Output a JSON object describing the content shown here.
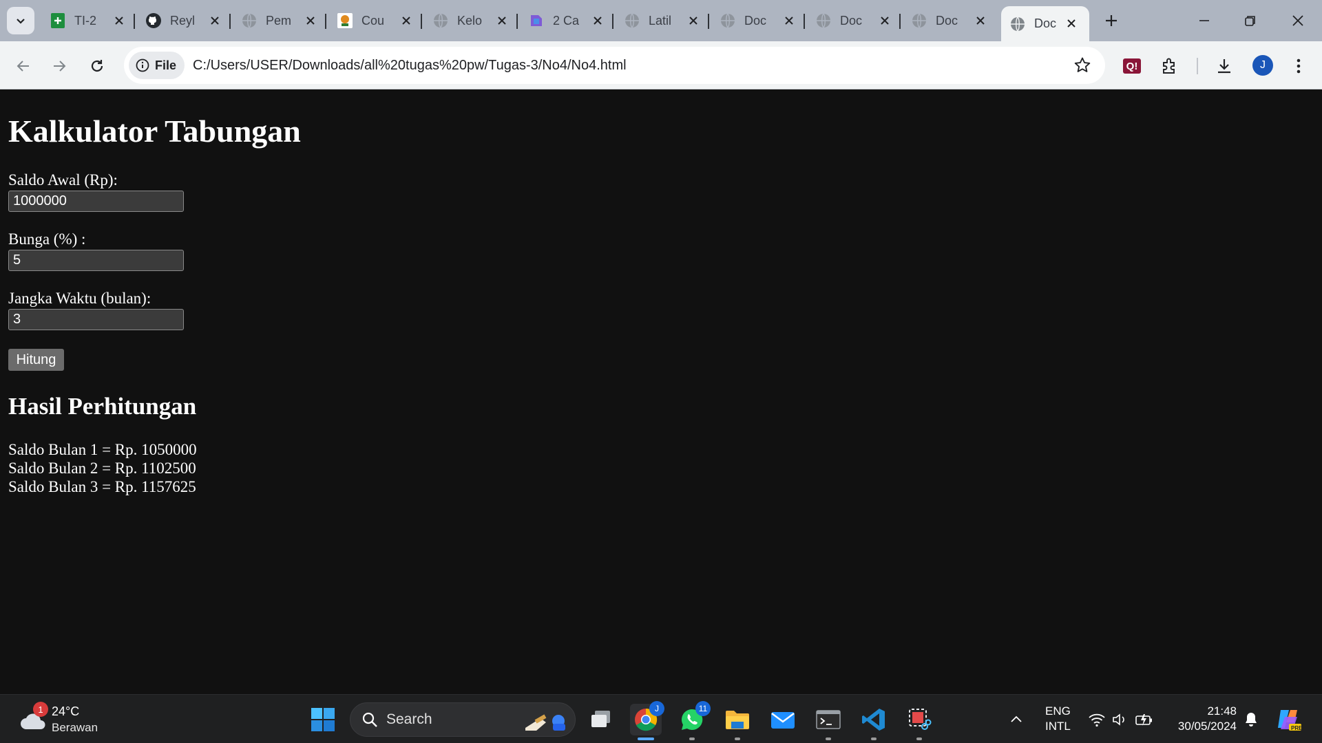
{
  "browser": {
    "tabs": [
      {
        "label": "TI-2",
        "icon": "sheets-icon"
      },
      {
        "label": "Reyl",
        "icon": "github-icon"
      },
      {
        "label": "Pem",
        "icon": "globe-icon"
      },
      {
        "label": "Cou",
        "icon": "site-icon"
      },
      {
        "label": "Kelo",
        "icon": "globe-icon"
      },
      {
        "label": "2 Ca",
        "icon": "app-icon"
      },
      {
        "label": "Latil",
        "icon": "globe-icon"
      },
      {
        "label": "Doc",
        "icon": "globe-icon"
      },
      {
        "label": "Doc",
        "icon": "globe-icon"
      },
      {
        "label": "Doc",
        "icon": "globe-icon"
      },
      {
        "label": "Doc",
        "icon": "globe-icon",
        "active": true
      }
    ],
    "address": {
      "chip_label": "File",
      "url": "C:/Users/USER/Downloads/all%20tugas%20pw/Tugas-3/No4/No4.html"
    },
    "profile_initial": "J",
    "extension_label": "Q!"
  },
  "page": {
    "title": "Kalkulator Tabungan",
    "fields": [
      {
        "label": "Saldo Awal (Rp):",
        "value": "1000000"
      },
      {
        "label": "Bunga (%) :",
        "value": "5"
      },
      {
        "label": "Jangka Waktu (bulan):",
        "value": "3"
      }
    ],
    "button_label": "Hitung",
    "result_heading": "Hasil Perhitungan",
    "results": [
      "Saldo Bulan 1 = Rp. 1050000",
      "Saldo Bulan 2 = Rp. 1102500",
      "Saldo Bulan 3 = Rp. 1157625"
    ]
  },
  "taskbar": {
    "weather": {
      "temp": "24°C",
      "condition": "Berawan",
      "badge": "1"
    },
    "search_label": "Search",
    "whatsapp_badge": "11",
    "chrome_badge": "J",
    "language": {
      "line1": "ENG",
      "line2": "INTL"
    },
    "clock": {
      "time": "21:48",
      "date": "30/05/2024"
    },
    "copilot_label": "PRE"
  },
  "colors": {
    "tabstrip": "#aeb5c1",
    "toolbar": "#f1f3f4",
    "page_background": "#111111",
    "taskbar": "#1f2021",
    "accent": "#1a56b8"
  }
}
